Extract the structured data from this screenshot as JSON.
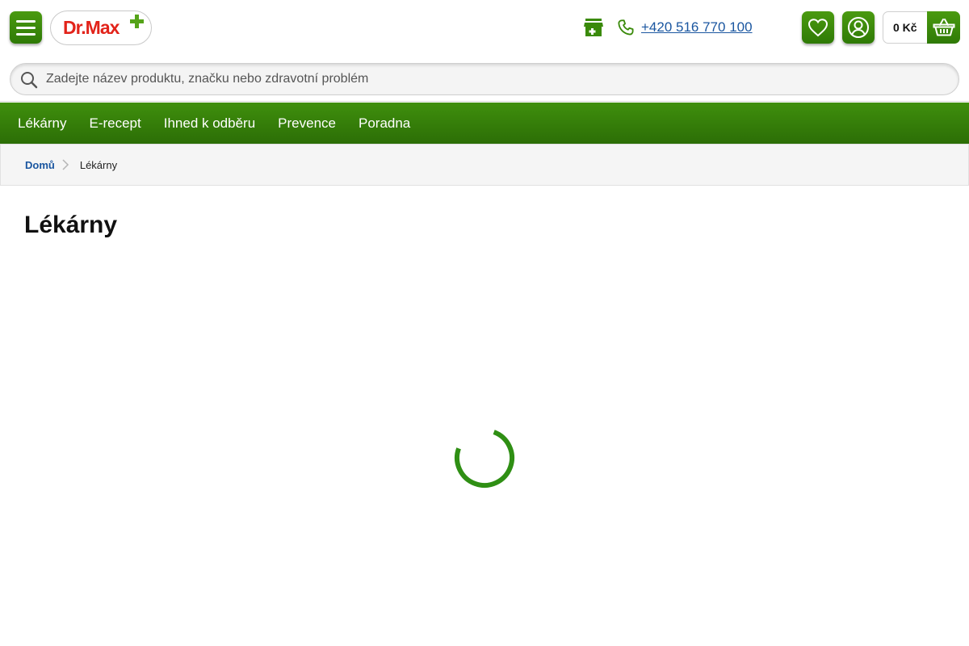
{
  "header": {
    "logo_text": "Dr.Max",
    "phone": "+420 516 770 100",
    "cart_price": "0 Kč"
  },
  "search": {
    "placeholder": "Zadejte název produktu, značku nebo zdravotní problém"
  },
  "nav": {
    "items": [
      "Lékárny",
      "E-recept",
      "Ihned k odběru",
      "Prevence",
      "Poradna"
    ]
  },
  "breadcrumb": {
    "home": "Domů",
    "current": "Lékárny"
  },
  "page": {
    "title": "Lékárny"
  },
  "icons": {
    "menu": "menu-icon",
    "store": "store-icon",
    "phone": "phone-icon",
    "wishlist": "heart-icon",
    "account": "user-icon",
    "cart": "basket-icon",
    "search": "search-icon",
    "separator": "chevron-right-icon",
    "loading": "spinner-icon"
  },
  "colors": {
    "brand_green": "#3a8a0a",
    "logo_red": "#e2231a",
    "link_blue": "#1a56a0"
  }
}
